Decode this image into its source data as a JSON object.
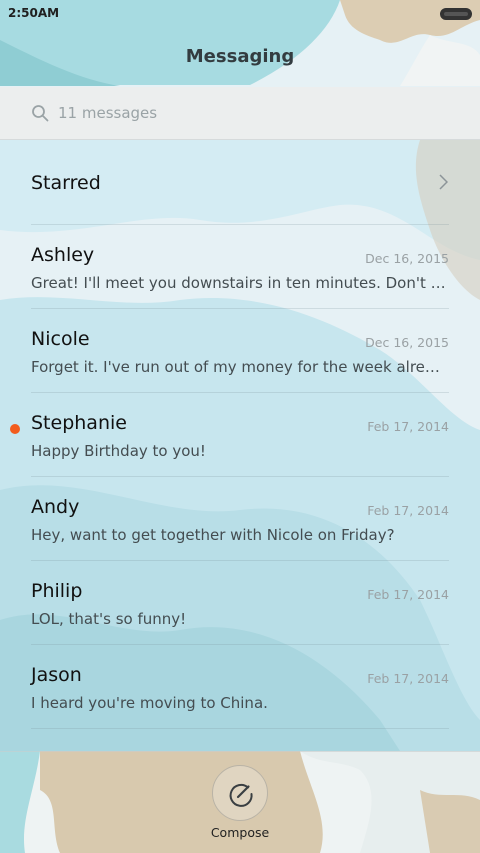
{
  "status_bar": {
    "time": "2:50AM"
  },
  "header": {
    "title": "Messaging"
  },
  "search": {
    "placeholder": "11 messages"
  },
  "starred": {
    "label": "Starred"
  },
  "conversations": [
    {
      "name": "Ashley",
      "date": "Dec 16, 2015",
      "preview": "Great! I'll meet you downstairs in ten minutes. Don't forget to bring the tickets.",
      "unread": false
    },
    {
      "name": "Nicole",
      "date": "Dec 16, 2015",
      "preview": "Forget it. I've run out of my money for the week already.",
      "unread": false
    },
    {
      "name": "Stephanie",
      "date": "Feb 17, 2014",
      "preview": "Happy Birthday to you!",
      "unread": true
    },
    {
      "name": "Andy",
      "date": "Feb 17, 2014",
      "preview": "Hey, want to get together with Nicole on Friday?",
      "unread": false
    },
    {
      "name": "Philip",
      "date": "Feb 17, 2014",
      "preview": "LOL, that's so funny!",
      "unread": false
    },
    {
      "name": "Jason",
      "date": "Feb 17, 2014",
      "preview": "I heard you're moving to China.",
      "unread": false
    }
  ],
  "bottom": {
    "compose_label": "Compose"
  },
  "colors": {
    "unread_dot": "#f25c1d",
    "accent_teal": "#a9dde3",
    "accent_tan": "#d8c9b0"
  }
}
